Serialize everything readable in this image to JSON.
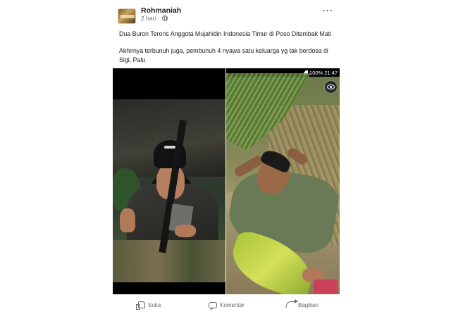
{
  "post": {
    "author": "Rohmaniah",
    "time": "2 hari",
    "separator": "·",
    "more_label": "···",
    "text_line1": "Dua Buron Teroris Anggota Mujahidin Indonesia Timur di Poso Ditembak Mati",
    "text_line2": "Akhirnya terbunuh juga, pembunuh 4 nyawa satu keluarga yg tak  berdosa di Sigi, Palu"
  },
  "photo_right": {
    "status_battery": "100%",
    "status_time": "21:47"
  },
  "actions": {
    "like_label": "Suka",
    "comment_label": "Komentar",
    "share_label": "Bagikan"
  },
  "colors": {
    "text": "#1c1e21",
    "secondary_text": "#65676b",
    "background": "#ffffff"
  },
  "icons": [
    "globe-icon",
    "more-icon",
    "like-icon",
    "comment-icon",
    "share-icon",
    "eye-icon"
  ]
}
